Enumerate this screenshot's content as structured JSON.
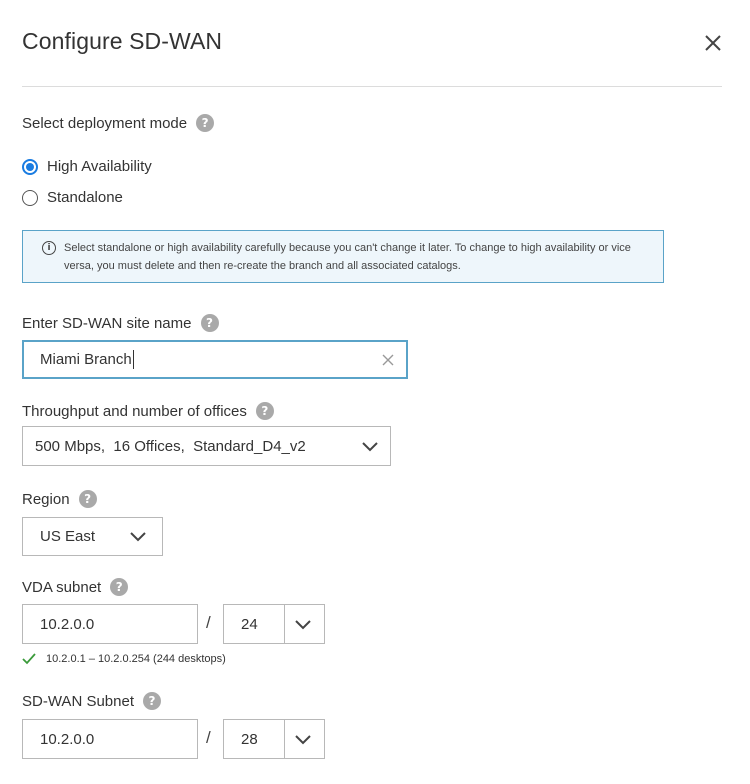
{
  "dialog": {
    "title": "Configure SD-WAN",
    "close_icon": "close-icon"
  },
  "deployment": {
    "label": "Select deployment mode",
    "help": "?",
    "options": [
      {
        "label": "High Availability",
        "selected": true
      },
      {
        "label": "Standalone",
        "selected": false
      }
    ],
    "info_icon": "i",
    "info_text": "Select standalone or high availability carefully because you can't change it later. To change to high availability or vice versa, you must delete and then re-create the branch and all associated catalogs."
  },
  "site_name": {
    "label": "Enter SD-WAN site name",
    "help": "?",
    "value": "Miami Branch"
  },
  "throughput": {
    "label": "Throughput and number of offices",
    "help": "?",
    "value": "500 Mbps,  16 Offices,  Standard_D4_v2"
  },
  "region": {
    "label": "Region",
    "help": "?",
    "value": "US East"
  },
  "vda_subnet": {
    "label": "VDA subnet",
    "help": "?",
    "ip": "10.2.0.0",
    "separator": "/",
    "prefix": "24",
    "validation": "10.2.0.1 – 10.2.0.254 (244 desktops)"
  },
  "sdwan_subnet": {
    "label": "SD-WAN Subnet",
    "help": "?",
    "ip": "10.2.0.0",
    "separator": "/",
    "prefix": "28"
  },
  "colors": {
    "accent": "#1a7ce1",
    "focus_border": "#5aa3c8",
    "info_bg": "#eef6fb",
    "valid_check": "#3a9a3a"
  }
}
